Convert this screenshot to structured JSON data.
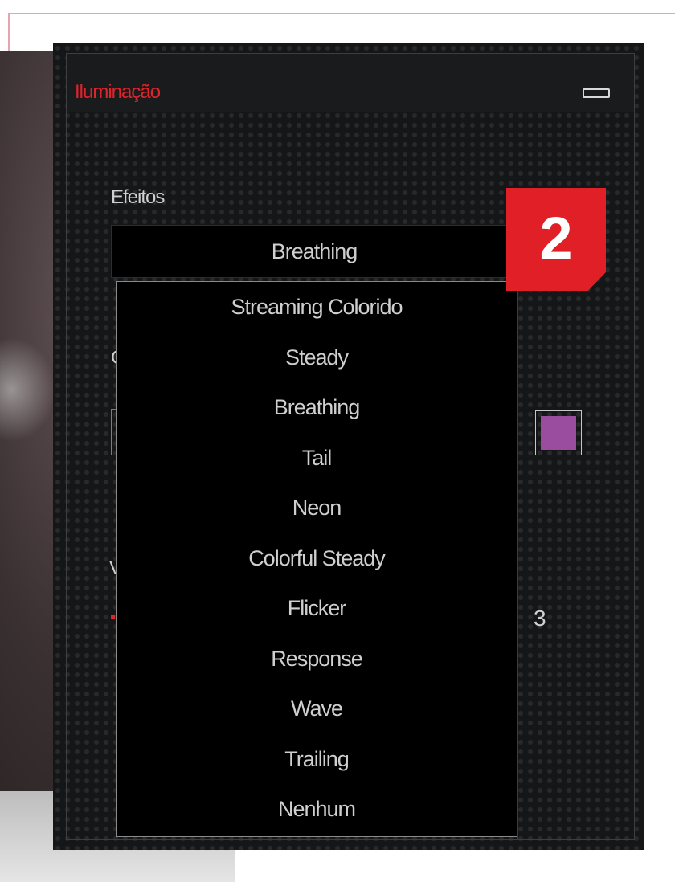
{
  "window": {
    "title": "Iluminação",
    "accent_color": "#e0242c"
  },
  "effects": {
    "label": "Efeitos",
    "selected": "Breathing",
    "options": [
      "Streaming Colorido",
      "Steady",
      "Breathing",
      "Tail",
      "Neon",
      "Colorful Steady",
      "Flicker",
      "Response",
      "Wave",
      "Trailing",
      "Nenhum"
    ]
  },
  "peek": {
    "letter_c": "C",
    "letter_v": "V"
  },
  "color_swatch": "#9a4c9e",
  "value": "3",
  "badge": {
    "text": "2",
    "color": "#e11f26"
  },
  "icons": {
    "minimize": "minimize-icon"
  }
}
